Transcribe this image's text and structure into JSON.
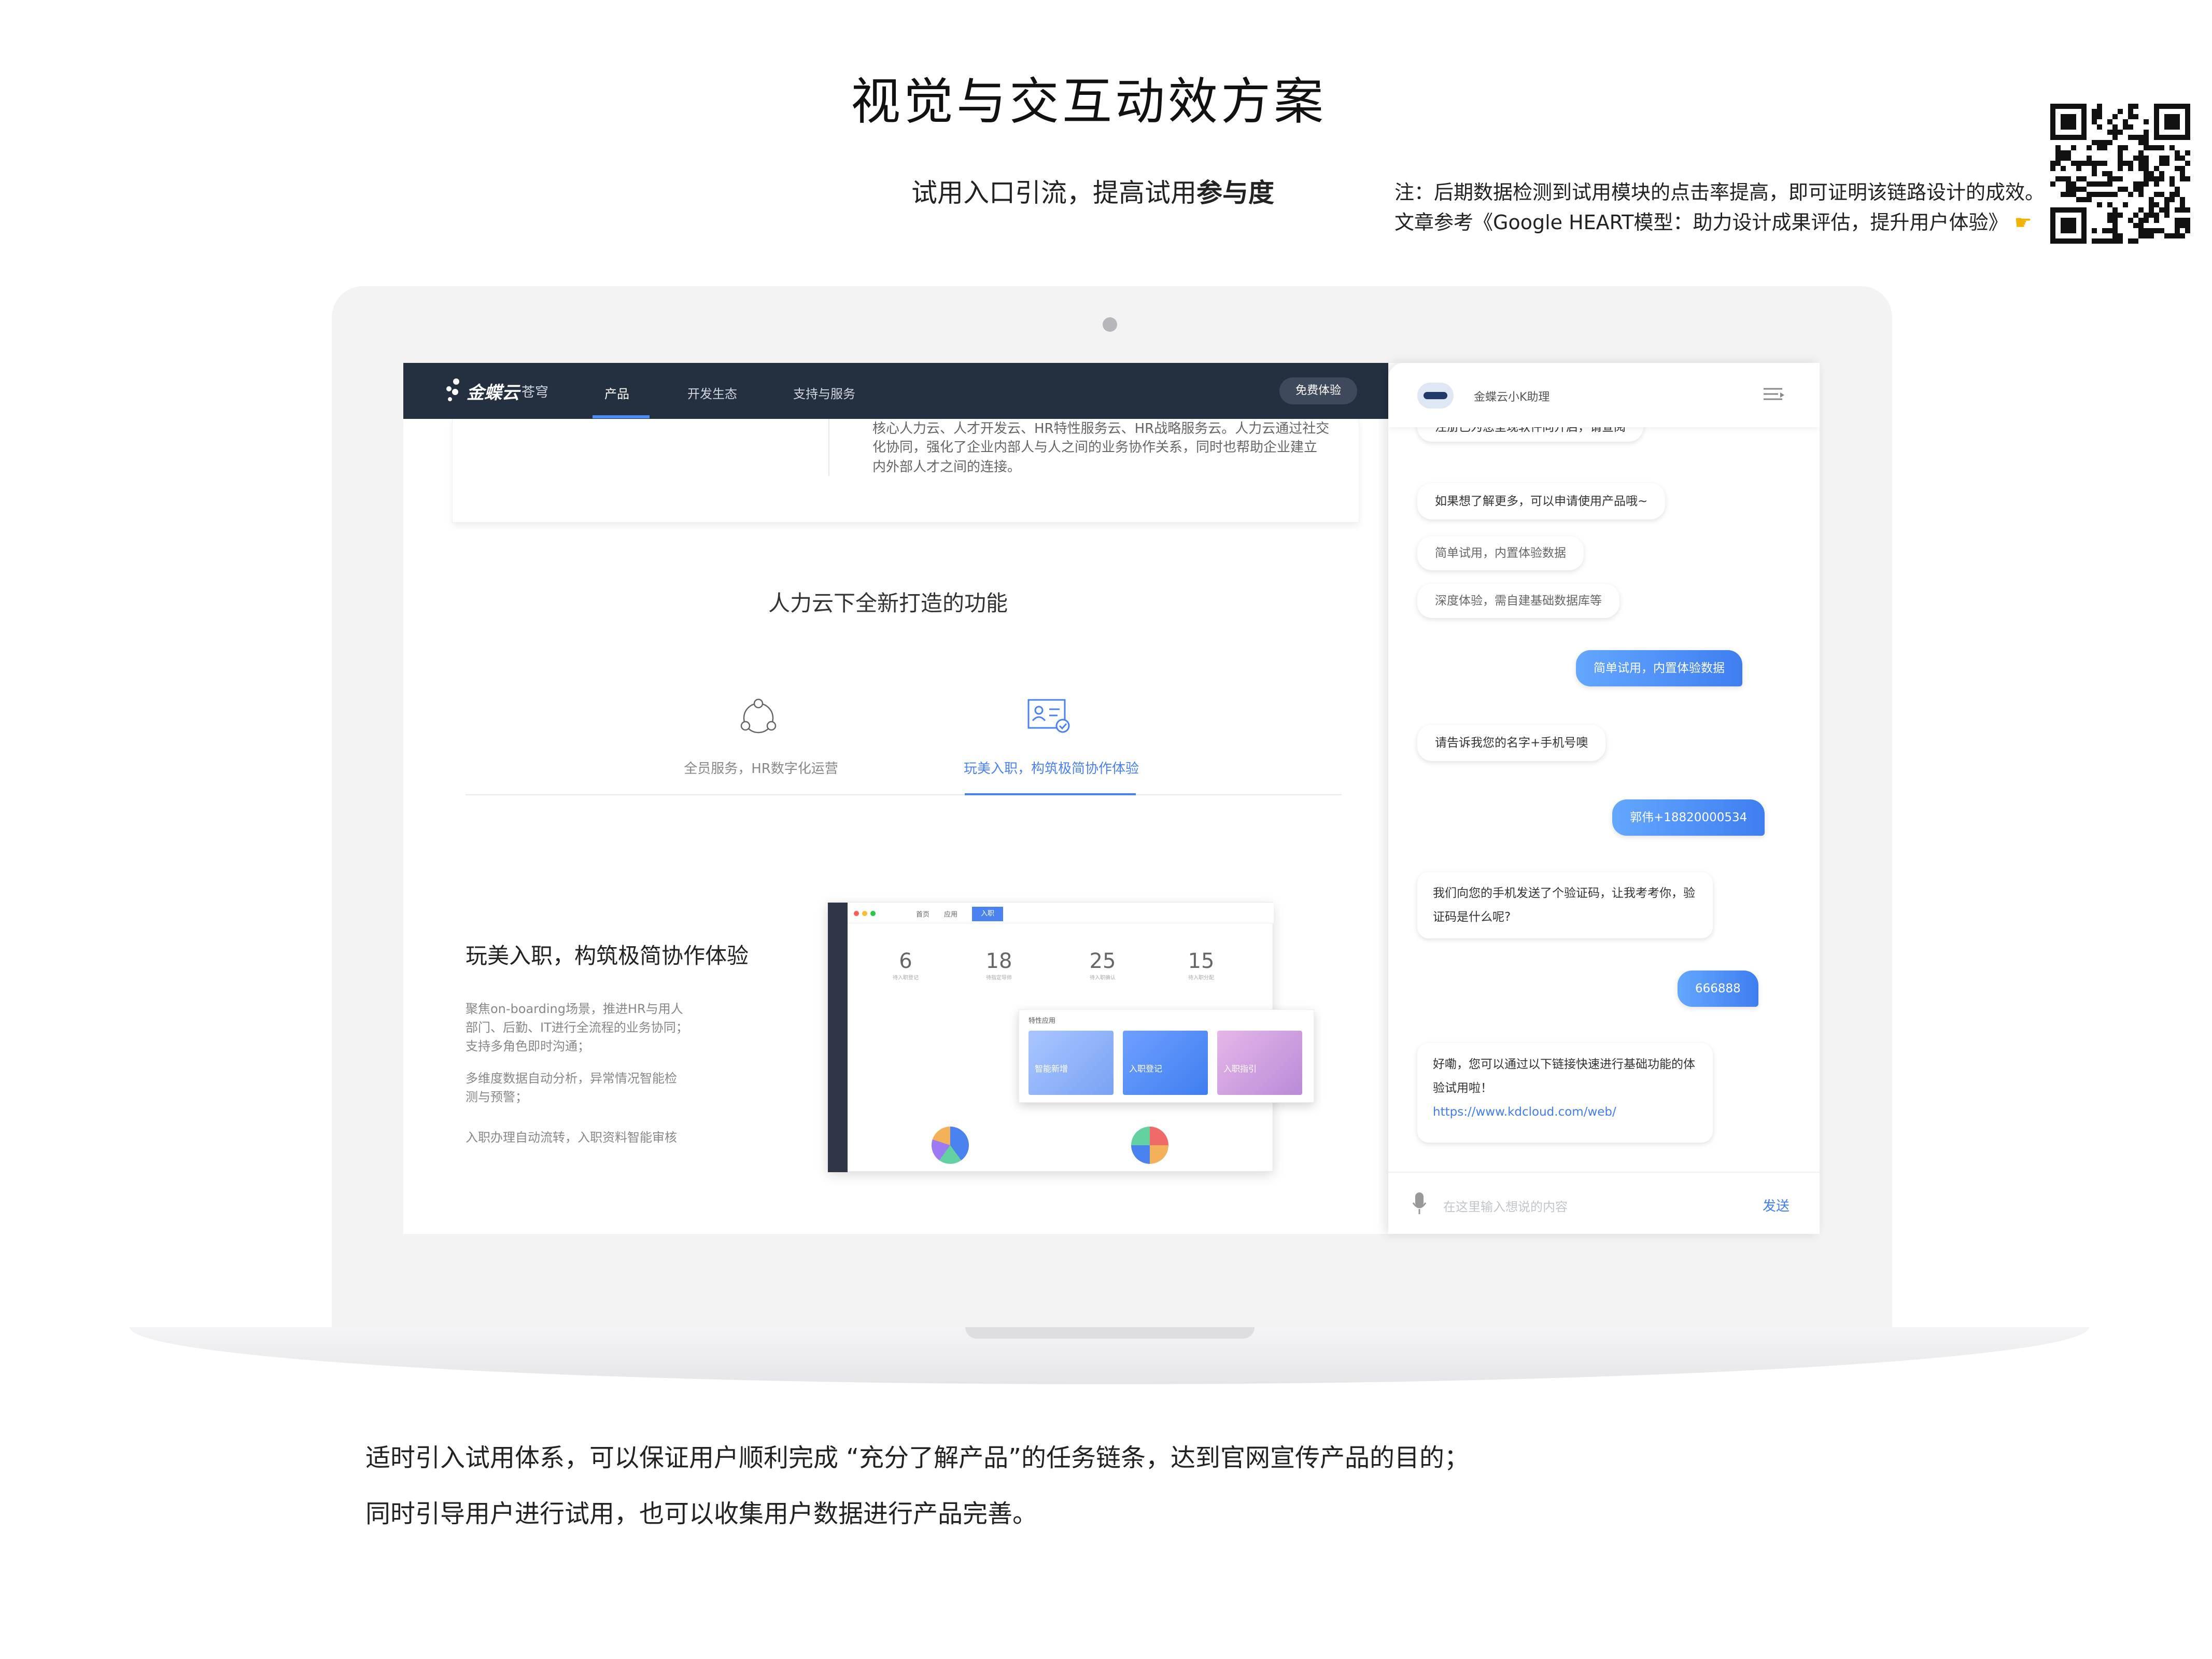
{
  "header": {
    "title": "视觉与交互动效方案",
    "subtitle_prefix": "试用入口引流，提高试用",
    "subtitle_bold": "参与度",
    "note_line_1": "注：后期数据检测到试用模块的点击率提高，即可证明该链路设计的成效。",
    "note_line_2": "文章参考《Google HEART模型：助力设计成果评估，提升用户体验》",
    "note_icon": "pointing-hand-icon"
  },
  "site": {
    "logo_text": "金蝶云",
    "logo_sub": "苍穹",
    "nav": [
      "产品",
      "开发生态",
      "支持与服务"
    ],
    "trial_button": "免费体验",
    "intro_lines": [
      "核心人力云、人才开发云、HR特性服务云、HR战略服务云。人力云通过社交",
      "化协同，强化了企业内部人与人之间的业务协作关系，同时也帮助企业建立",
      "内外部人才之间的连接。"
    ],
    "features_title": "人力云下全新打造的功能",
    "feature_tabs": [
      {
        "label": "全员服务，HR数字化运营",
        "icon": "network-icon"
      },
      {
        "label": "玩美入职，构筑极简协作体验",
        "icon": "id-card-icon"
      }
    ],
    "detail": {
      "title": "玩美入职，构筑极简协作体验",
      "p1": [
        "聚焦on-boarding场景，推进HR与用人",
        "部门、后勤、IT进行全流程的业务协同；",
        "支持多角色即时沟通；"
      ],
      "p2": [
        "多维度数据自动分析，异常情况智能检",
        "测与预警；"
      ],
      "p3": [
        "入职办理自动流转，入职资料智能审核"
      ]
    },
    "dashboard": {
      "tabs": [
        "首页",
        "应用",
        "入职"
      ],
      "kpis": [
        {
          "value": "6",
          "caption": "待入职登记"
        },
        {
          "value": "18",
          "caption": "待指定导师"
        },
        {
          "value": "25",
          "caption": "待入职确认"
        },
        {
          "value": "15",
          "caption": "待入职分配"
        }
      ],
      "panel_title": "特性应用",
      "apps": [
        "智能新增",
        "入职登记",
        "入职指引"
      ]
    }
  },
  "chat": {
    "title": "金蝶云小K助理",
    "messages": [
      {
        "from": "bot",
        "text": "注册已为您呈现软件向开启，请查阅"
      },
      {
        "from": "bot",
        "text": "如果想了解更多，可以申请使用产品哦~"
      },
      {
        "from": "option",
        "text": "简单试用，内置体验数据"
      },
      {
        "from": "option",
        "text": "深度体验，需自建基础数据库等"
      },
      {
        "from": "user",
        "text": "简单试用，内置体验数据"
      },
      {
        "from": "bot",
        "text": "请告诉我您的名字+手机号噢"
      },
      {
        "from": "user",
        "text": "郭伟+18820000534"
      },
      {
        "from": "bot",
        "text": "我们向您的手机发送了个验证码，让我考考你，验证码是什么呢?"
      },
      {
        "from": "user",
        "text": "666888"
      },
      {
        "from": "bot",
        "text": "好嘞，您可以通过以下链接快速进行基础功能的体验试用啦！"
      },
      {
        "from": "link",
        "text": "https://www.kdcloud.com/web/"
      }
    ],
    "input_placeholder": "在这里输入想说的内容",
    "send_label": "发送"
  },
  "captions": {
    "line_1": "适时引入试用体系，可以保证用户顺利完成 “充分了解产品”的任务链条，达到官网宣传产品的目的；",
    "line_2": "同时引导用户进行试用，也可以收集用户数据进行产品完善。"
  },
  "colors": {
    "accent": "#4a83f0",
    "nav_bg": "#243040",
    "laptop_shell": "#f3f3f4"
  }
}
